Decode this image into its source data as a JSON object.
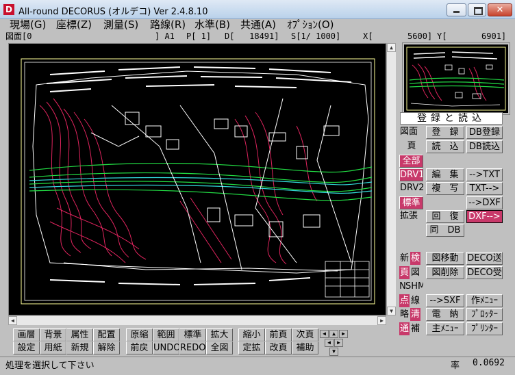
{
  "window": {
    "icon_letter": "D",
    "title": "All-round DECORUS (オルデコ) Ver 2.4.8.10",
    "close_glyph": "✕"
  },
  "menu": [
    {
      "label": "現場(G)"
    },
    {
      "label": "座標(Z)"
    },
    {
      "label": "測量(S)"
    },
    {
      "label": "路線(R)"
    },
    {
      "label": "水準(B)"
    },
    {
      "label": "共通(A)"
    },
    {
      "label": "ｵﾌﾟｼｮﾝ(O)"
    }
  ],
  "status": {
    "drawing": "図面[0",
    "sheet": "] A1",
    "page": "P[ 1]",
    "d_value": "D[   18491]",
    "scale": "S[1/ 1000]",
    "x_coord": "X[       5600]",
    "y_coord": "Y[       6901]"
  },
  "panel": {
    "header": "登録と読込",
    "col1": [
      {
        "label": "図面",
        "style": "normal"
      },
      {
        "label": "頁",
        "style": "normal"
      },
      {
        "label": "全部",
        "style": "hl"
      },
      {
        "label": "DRV1",
        "style": "hl"
      },
      {
        "label": "DRV2",
        "style": "normal"
      },
      {
        "label": "標準",
        "style": "hl"
      },
      {
        "label": "拡張",
        "style": "normal"
      }
    ],
    "col2": [
      {
        "label": "登　録"
      },
      {
        "label": "読　込"
      },
      {
        "label": "編　集"
      },
      {
        "label": "複　写"
      },
      {
        "label": "回　復"
      },
      {
        "label": "同　DB"
      }
    ],
    "col3": [
      {
        "label": "DB登録"
      },
      {
        "label": "DB読込"
      },
      {
        "label": "-->TXT"
      },
      {
        "label": "TXT-->"
      },
      {
        "label": "-->DXF"
      },
      {
        "label": "DXF-->"
      }
    ],
    "lower_col1": [
      {
        "a": "新",
        "b": "検",
        "a_hl": false,
        "b_hl": true
      },
      {
        "a": "頁",
        "b": "図",
        "a_hl": true,
        "b_hl": false
      },
      {
        "a": "N",
        "b": "SHM",
        "a_hl": false,
        "b_hl": false
      },
      {
        "a": "点",
        "b": "線",
        "a_hl": true,
        "b_hl": false
      },
      {
        "a": "略",
        "b": "清",
        "a_hl": false,
        "b_hl": true
      },
      {
        "a": "通",
        "b": "補",
        "a_hl": true,
        "b_hl": false
      }
    ],
    "lower_col2": [
      {
        "label": "図移動"
      },
      {
        "label": "図削除"
      },
      {
        "label": "-->SXF"
      },
      {
        "label": "電　納"
      },
      {
        "label": "主ﾒﾆｭｰ"
      }
    ],
    "lower_col3": [
      {
        "label": "DECO送"
      },
      {
        "label": "DECO受"
      },
      {
        "label": "作ﾒﾆｭｰ"
      },
      {
        "label": "ﾌﾟﾛｯﾀｰ"
      },
      {
        "label": "ﾌﾟﾘﾝﾀｰ"
      }
    ]
  },
  "toolbar": {
    "row1": [
      "画層",
      "背景",
      "属性",
      "配置",
      "原縮",
      "範囲",
      "標準",
      "拡大",
      "縮小",
      "前頁",
      "次頁"
    ],
    "row2": [
      "設定",
      "用紙",
      "新規",
      "解除",
      "前戻",
      "UNDO",
      "REDO",
      "全図",
      "定拡",
      "改頁",
      "補助"
    ]
  },
  "bottom": {
    "message": "処理を選択して下さい",
    "rate_label": "率",
    "rate_value": "0.0692"
  },
  "colors": {
    "accent": "#c8396a",
    "canvas_bg": "#000000",
    "frame": "#ffff99"
  }
}
